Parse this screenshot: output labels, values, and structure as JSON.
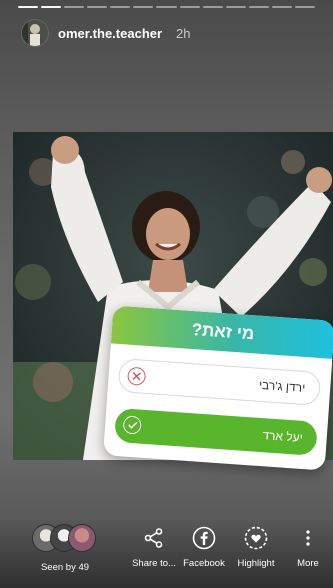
{
  "story": {
    "username": "omer.the.teacher",
    "time": "2h",
    "progress_segments": 13,
    "progress_done": 2
  },
  "quiz": {
    "question": "מי זאת?",
    "options": [
      {
        "label": "ירדן ג'רבי",
        "correct": false
      },
      {
        "label": "יעל ארד",
        "correct": true
      }
    ]
  },
  "footer": {
    "seen_by": "Seen by 49",
    "share": "Share to...",
    "facebook": "Facebook",
    "highlight": "Highlight",
    "more": "More"
  },
  "colors": {
    "quiz_gradient": [
      "#8bc53f",
      "#1fc0e0"
    ],
    "correct": "#59b52c",
    "wrong": "#e05858"
  }
}
